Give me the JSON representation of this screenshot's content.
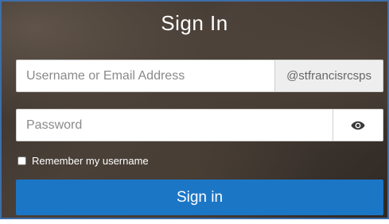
{
  "title": "Sign In",
  "username": {
    "placeholder": "Username or Email Address",
    "value": "",
    "domain_suffix": "@stfrancisrcsps"
  },
  "password": {
    "placeholder": "Password",
    "value": "",
    "toggle_icon": "eye-icon"
  },
  "remember": {
    "label": "Remember my username",
    "checked": false
  },
  "submit_label": "Sign in",
  "colors": {
    "frame_border": "#3e6ea8",
    "button": "#1c76c6"
  }
}
